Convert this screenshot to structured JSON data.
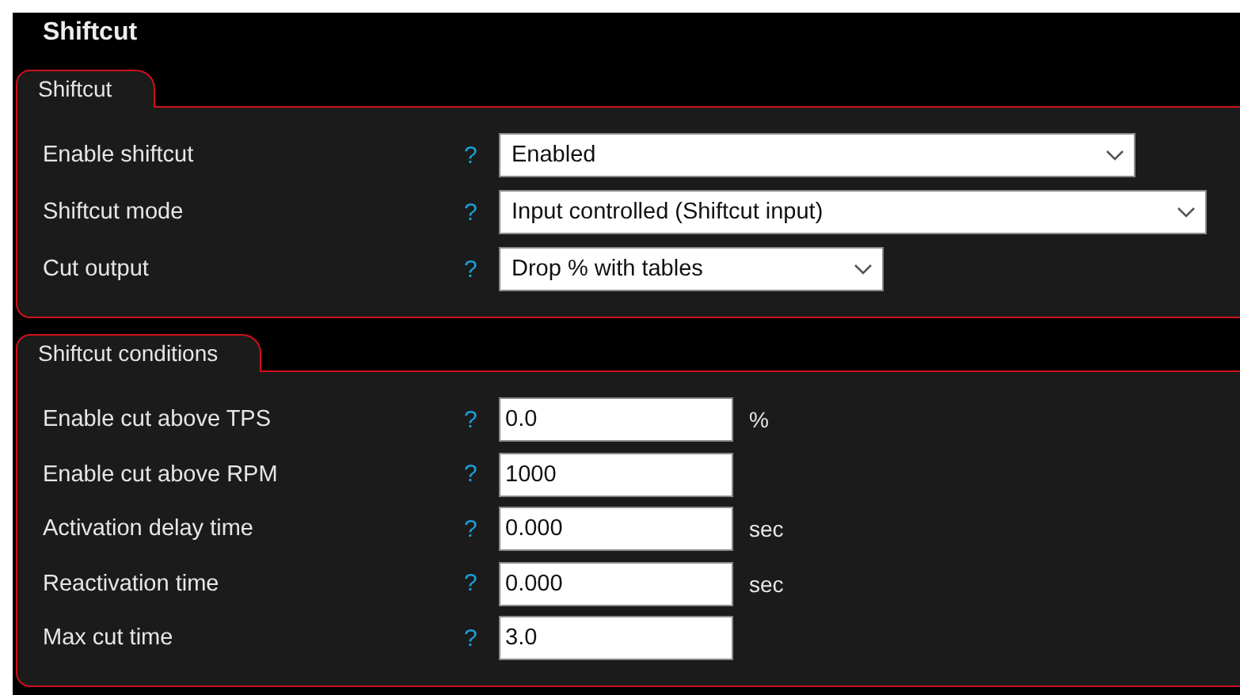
{
  "window": {
    "title": "Shiftcut"
  },
  "groups": [
    {
      "title": "Shiftcut",
      "rows": [
        {
          "label": "Enable shiftcut",
          "help": "?",
          "kind": "select",
          "value": "Enabled"
        },
        {
          "label": "Shiftcut mode",
          "help": "?",
          "kind": "select",
          "value": "Input controlled (Shiftcut input)"
        },
        {
          "label": "Cut output",
          "help": "?",
          "kind": "select",
          "value": "Drop % with tables"
        }
      ]
    },
    {
      "title": "Shiftcut conditions",
      "rows": [
        {
          "label": "Enable cut above TPS",
          "help": "?",
          "kind": "number",
          "value": "0.0",
          "unit": "%"
        },
        {
          "label": "Enable cut above RPM",
          "help": "?",
          "kind": "number",
          "value": "1000"
        },
        {
          "label": "Activation delay time",
          "help": "?",
          "kind": "number",
          "value": "0.000",
          "unit": "sec"
        },
        {
          "label": "Reactivation time",
          "help": "?",
          "kind": "number",
          "value": "0.000",
          "unit": "sec"
        },
        {
          "label": "Max cut time",
          "help": "?",
          "kind": "number",
          "value": "3.0"
        }
      ]
    }
  ]
}
